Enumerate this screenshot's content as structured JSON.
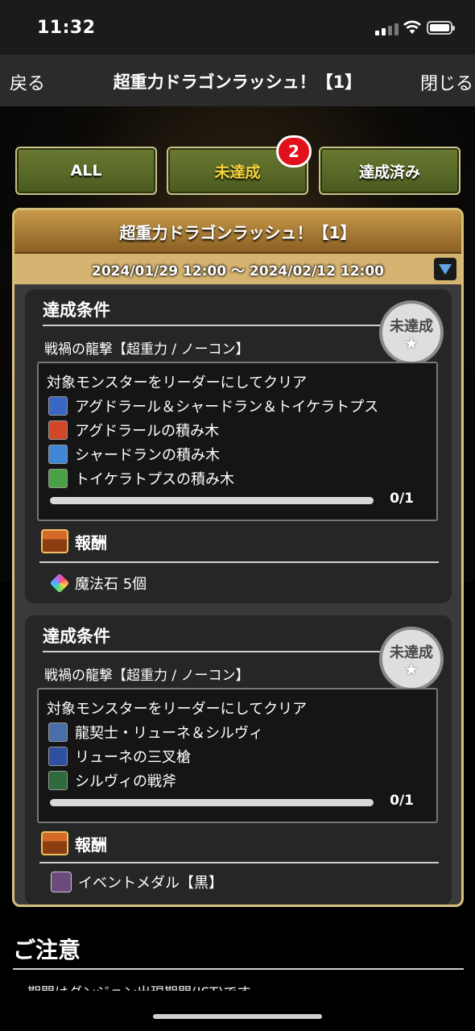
{
  "status_bar": {
    "time": "11:32"
  },
  "nav": {
    "back": "戻る",
    "title": "超重力ドラゴンラッシュ！【1】",
    "close": "閉じる"
  },
  "tabs": [
    {
      "label": "ALL"
    },
    {
      "label": "未達成",
      "badge": "2"
    },
    {
      "label": "達成済み"
    }
  ],
  "event": {
    "title": "超重力ドラゴンラッシュ！【1】",
    "period": "2024/01/29 12:00 ～ 2024/02/12 12:00"
  },
  "missions": [
    {
      "heading": "達成条件",
      "status": "未達成",
      "dungeon": "戦禍の龍撃【超重力 / ノーコン】",
      "condition": "対象モンスターをリーダーにしてクリア",
      "monsters": [
        {
          "name": "アグドラール＆シャードラン＆トイケラトプス",
          "color": "#3a66c4"
        },
        {
          "name": "アグドラールの積み木",
          "color": "#d2462a"
        },
        {
          "name": "シャードランの積み木",
          "color": "#3f86d6"
        },
        {
          "name": "トイケラトプスの積み木",
          "color": "#4aa046"
        }
      ],
      "progress_text": "0/1",
      "progress": 0,
      "reward_heading": "報酬",
      "reward": "魔法石 5個"
    },
    {
      "heading": "達成条件",
      "status": "未達成",
      "dungeon": "戦禍の龍撃【超重力 / ノーコン】",
      "condition": "対象モンスターをリーダーにしてクリア",
      "monsters": [
        {
          "name": "龍契士・リューネ＆シルヴィ",
          "color": "#4a6fa8"
        },
        {
          "name": "リューネの三叉槍",
          "color": "#2f4fa0"
        },
        {
          "name": "シルヴィの戦斧",
          "color": "#2f6a3e"
        }
      ],
      "progress_text": "0/1",
      "progress": 0,
      "reward_heading": "報酬",
      "reward": "イベントメダル【黒】"
    }
  ],
  "notes": {
    "title": "ご注意",
    "text": "期間はダンジョン出現期間(JST)です。"
  }
}
